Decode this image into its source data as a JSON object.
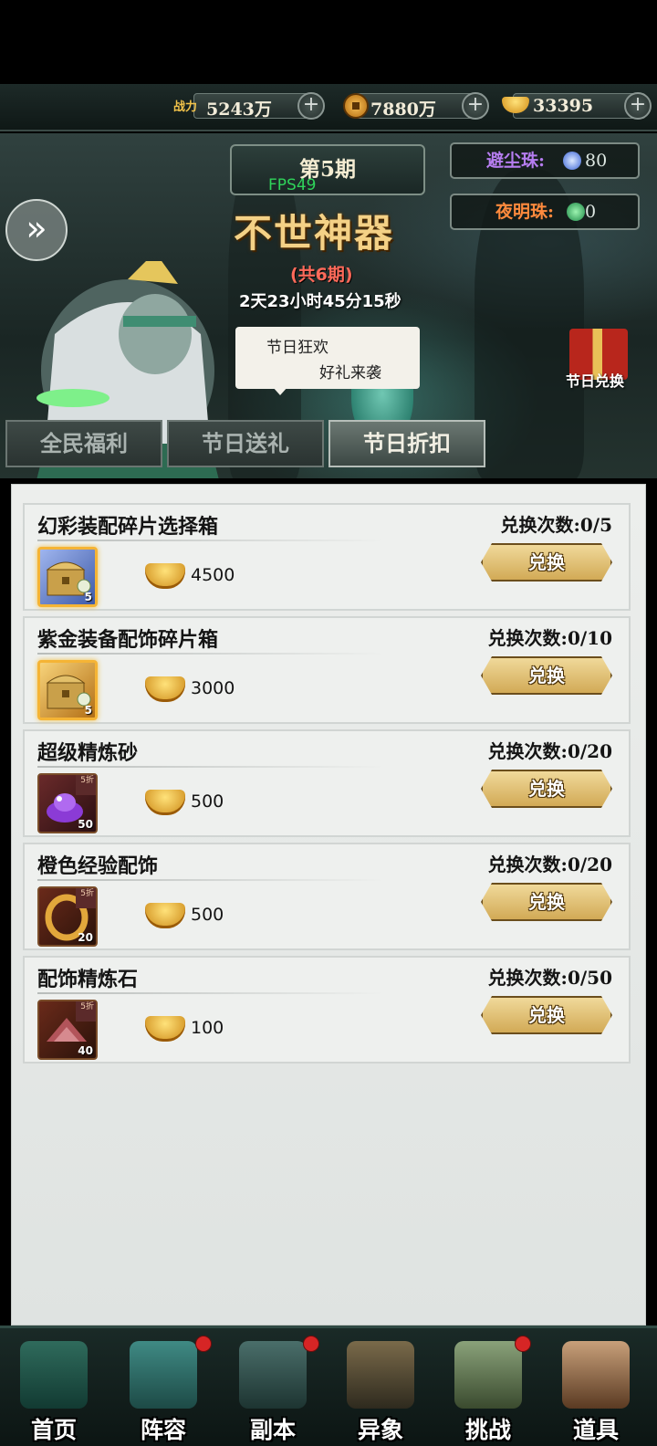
{
  "resources": {
    "power_label": "战力",
    "power_value": "5243万",
    "coins_value": "7880万",
    "ingots_value": "33395",
    "plus": "+"
  },
  "banner": {
    "period": "第5期",
    "fps": "FPS49",
    "title": "不世神器",
    "total_periods": "(共6期)",
    "timer": "2天23小时45分15秒",
    "bubble_line1": "节日狂欢",
    "bubble_line2": "好礼来袭",
    "pearl1_label": "避尘珠:",
    "pearl1_value": "80",
    "pearl2_label": "夜明珠:",
    "pearl2_value": "0",
    "gift_label": "节日兑换",
    "expand_glyph": "»"
  },
  "tabs": [
    "全民福利",
    "节日送礼",
    "节日折扣"
  ],
  "items": [
    {
      "name": "幻彩装配碎片选择箱",
      "count": "兑换次数:0/5",
      "price": "4500",
      "qty": "5",
      "discount": "",
      "button": "兑换"
    },
    {
      "name": "紫金装备配饰碎片箱",
      "count": "兑换次数:0/10",
      "price": "3000",
      "qty": "5",
      "discount": "",
      "button": "兑换"
    },
    {
      "name": "超级精炼砂",
      "count": "兑换次数:0/20",
      "price": "500",
      "qty": "50",
      "discount": "5折",
      "button": "兑换"
    },
    {
      "name": "橙色经验配饰",
      "count": "兑换次数:0/20",
      "price": "500",
      "qty": "20",
      "discount": "5折",
      "button": "兑换"
    },
    {
      "name": "配饰精炼石",
      "count": "兑换次数:0/50",
      "price": "100",
      "qty": "40",
      "discount": "5折",
      "button": "兑换"
    }
  ],
  "nav": [
    {
      "label": "首页"
    },
    {
      "label": "阵容"
    },
    {
      "label": "副本"
    },
    {
      "label": "异象"
    },
    {
      "label": "挑战"
    },
    {
      "label": "道具"
    }
  ],
  "colors": {
    "accent_gold": "#d2aa56",
    "badge_red": "#d62525",
    "fps_green": "#2fd35a",
    "pearl1_purple": "#b67df0",
    "pearl2_orange": "#ff8a3d"
  }
}
